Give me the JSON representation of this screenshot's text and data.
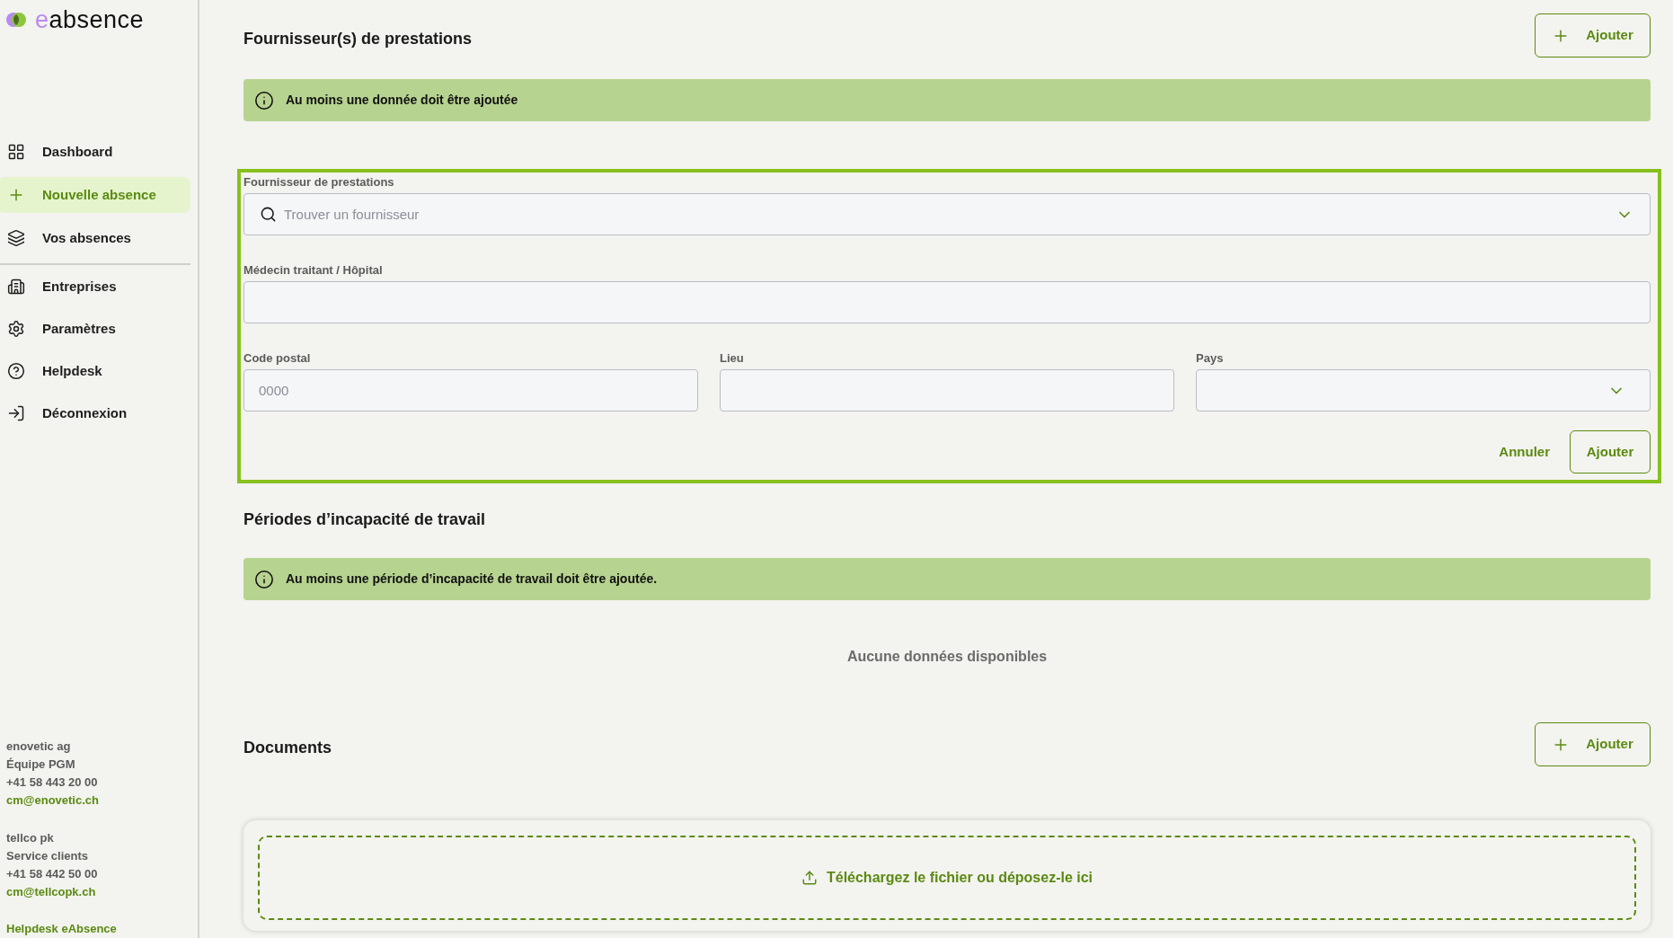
{
  "logo": {
    "accent": "e",
    "rest": "absence"
  },
  "sidebar": {
    "groups": [
      {
        "items": [
          {
            "label": "Dashboard",
            "selected": false
          },
          {
            "label": "Nouvelle absence",
            "selected": true
          },
          {
            "label": "Vos absences",
            "selected": false
          }
        ]
      },
      {
        "items": [
          {
            "label": "Entreprises",
            "selected": false
          },
          {
            "label": "Paramètres",
            "selected": false
          },
          {
            "label": "Helpdesk",
            "selected": false
          },
          {
            "label": "Déconnexion",
            "selected": false
          }
        ]
      }
    ],
    "contacts": [
      {
        "lines": [
          "enovetic ag",
          "Équipe PGM",
          "+41 58 443 20 00"
        ],
        "email": "cm@enovetic.ch"
      },
      {
        "lines": [
          "tellco pk",
          "Service clients",
          "+41 58 442 50 00"
        ],
        "email": "cm@tellcopk.ch"
      }
    ],
    "helpdesk_link": "Helpdesk eAbsence"
  },
  "providers": {
    "title": "Fournisseur(s) de prestations",
    "add_button": "Ajouter",
    "notice": "Au moins une donnée doit être ajoutée",
    "form": {
      "rows": [
        {
          "fields": [
            {
              "kind": "search",
              "label": "Fournisseur de prestations",
              "placeholder": "Trouver un fournisseur"
            }
          ]
        },
        {
          "fields": [
            {
              "kind": "text",
              "label": "Médecin traitant / Hôpital"
            }
          ]
        },
        {
          "fields": [
            {
              "kind": "text",
              "label": "Code postal",
              "placeholder": "0000"
            },
            {
              "kind": "text",
              "label": "Lieu"
            },
            {
              "kind": "select",
              "label": "Pays"
            }
          ]
        }
      ],
      "cancel_button": "Annuler",
      "submit_button": "Ajouter"
    }
  },
  "periods": {
    "title": "Périodes d’incapacité de travail",
    "notice": "Au moins une période d’incapacité de travail doit être ajoutée.",
    "empty_text": "Aucune données disponibles"
  },
  "documents": {
    "title": "Documents",
    "add_button": "Ajouter",
    "upload_text": "Téléchargez le fichier ou déposez-le ici"
  }
}
